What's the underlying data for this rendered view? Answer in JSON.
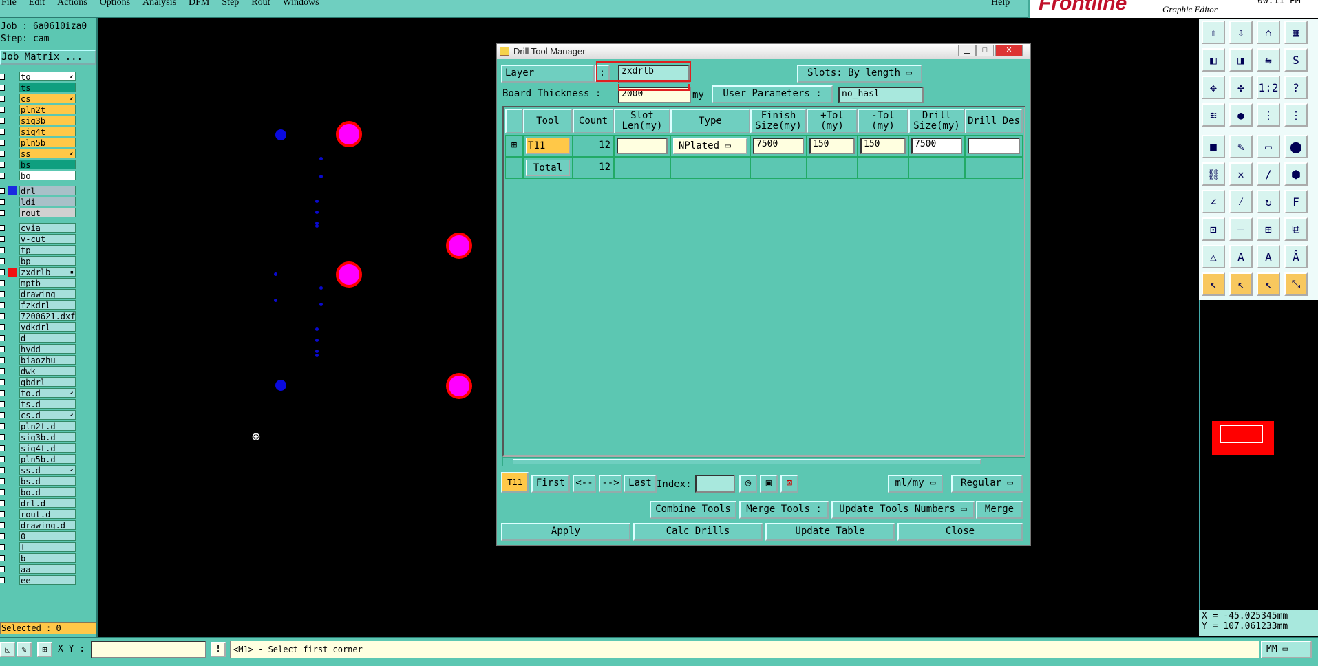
{
  "menubar": {
    "items": [
      "File",
      "Edit",
      "Actions",
      "Options",
      "Analysis",
      "DFM",
      "Step",
      "Rout",
      "Windows"
    ],
    "help": "Help"
  },
  "brand": {
    "logo": "Frontline",
    "subtitle": "Graphic Editor",
    "clock": "00:11 PM"
  },
  "left_panel": {
    "job": "Job : 6a0610iza0",
    "step": "Step: cam",
    "job_matrix_label": "Job Matrix ...",
    "layers": [
      {
        "name": "to",
        "color": "#ffffff",
        "marker": "⬋"
      },
      {
        "name": "ts",
        "color": "#0f9f7f",
        "marker": ""
      },
      {
        "name": "cs",
        "color": "#ffc848",
        "marker": "⬋"
      },
      {
        "name": "pln2t",
        "color": "#ffc848",
        "marker": ""
      },
      {
        "name": "sig3b",
        "color": "#ffc848",
        "marker": ""
      },
      {
        "name": "sig4t",
        "color": "#ffc848",
        "marker": ""
      },
      {
        "name": "pln5b",
        "color": "#ffc848",
        "marker": ""
      },
      {
        "name": "ss",
        "color": "#ffc848",
        "marker": "⬋"
      },
      {
        "name": "bs",
        "color": "#0f9f7f",
        "marker": ""
      },
      {
        "name": "bo",
        "color": "#ffffff",
        "marker": ""
      },
      {
        "name": "drl",
        "color": "#a8c0c8",
        "marker": ""
      },
      {
        "name": "ldi",
        "color": "#a8c0c8",
        "marker": ""
      },
      {
        "name": "rout",
        "color": "#d0d0d0",
        "marker": ""
      },
      {
        "name": "cvia",
        "color": "#a6dfdc",
        "marker": ""
      },
      {
        "name": "v-cut",
        "color": "#a6dfdc",
        "marker": ""
      },
      {
        "name": "tp",
        "color": "#a6dfdc",
        "marker": ""
      },
      {
        "name": "bp",
        "color": "#a6dfdc",
        "marker": ""
      },
      {
        "name": "zxdrlb",
        "color": "#a6dfdc",
        "marker": "▪"
      },
      {
        "name": "mptb",
        "color": "#a6dfdc",
        "marker": ""
      },
      {
        "name": "drawing",
        "color": "#a6dfdc",
        "marker": ""
      },
      {
        "name": "fzkdrl",
        "color": "#a6dfdc",
        "marker": ""
      },
      {
        "name": "7200621.dxf",
        "color": "#a6dfdc",
        "marker": ""
      },
      {
        "name": "ydkdrl",
        "color": "#a6dfdc",
        "marker": ""
      },
      {
        "name": "d",
        "color": "#a6dfdc",
        "marker": ""
      },
      {
        "name": "hydd",
        "color": "#a6dfdc",
        "marker": ""
      },
      {
        "name": "biaozhu",
        "color": "#a6dfdc",
        "marker": ""
      },
      {
        "name": "dwk",
        "color": "#a6dfdc",
        "marker": ""
      },
      {
        "name": "gbdrl",
        "color": "#a6dfdc",
        "marker": ""
      },
      {
        "name": "to.d",
        "color": "#a6dfdc",
        "marker": "⬋"
      },
      {
        "name": "ts.d",
        "color": "#a6dfdc",
        "marker": ""
      },
      {
        "name": "cs.d",
        "color": "#a6dfdc",
        "marker": "⬋"
      },
      {
        "name": "pln2t.d",
        "color": "#a6dfdc",
        "marker": ""
      },
      {
        "name": "sig3b.d",
        "color": "#a6dfdc",
        "marker": ""
      },
      {
        "name": "sig4t.d",
        "color": "#a6dfdc",
        "marker": ""
      },
      {
        "name": "pln5b.d",
        "color": "#a6dfdc",
        "marker": ""
      },
      {
        "name": "ss.d",
        "color": "#a6dfdc",
        "marker": "⬋"
      },
      {
        "name": "bs.d",
        "color": "#a6dfdc",
        "marker": ""
      },
      {
        "name": "bo.d",
        "color": "#a6dfdc",
        "marker": ""
      },
      {
        "name": "drl.d",
        "color": "#a6dfdc",
        "marker": ""
      },
      {
        "name": "rout.d",
        "color": "#a6dfdc",
        "marker": ""
      },
      {
        "name": "drawing.d",
        "color": "#a6dfdc",
        "marker": ""
      },
      {
        "name": "0",
        "color": "#a6dfdc",
        "marker": ""
      },
      {
        "name": "t",
        "color": "#a6dfdc",
        "marker": ""
      },
      {
        "name": "b",
        "color": "#a6dfdc",
        "marker": ""
      },
      {
        "name": "aa",
        "color": "#a6dfdc",
        "marker": ""
      },
      {
        "name": "ee",
        "color": "#a6dfdc",
        "marker": ""
      }
    ],
    "selected": "Selected : 0"
  },
  "dialog": {
    "title": "Drill Tool Manager",
    "layer_label": "Layer",
    "colon": ":",
    "layer_value": "zxdrlb",
    "slots_label": "Slots:",
    "slots_value": "By length",
    "board_thickness_label": "Board Thickness :",
    "board_thickness_value": "2000",
    "unit": "my",
    "user_params_label": "User Parameters :",
    "user_params_value": "no_hasl",
    "columns": [
      "Tool",
      "Count",
      "Slot Len(my)",
      "Type",
      "Finish Size(my)",
      "+Tol (my)",
      "-Tol (my)",
      "Drill Size(my)",
      "Drill Des"
    ],
    "rows": [
      {
        "tool": "T11",
        "count": "12",
        "slot_len": "",
        "type": "NPlated",
        "finish": "7500",
        "ptol": "150",
        "mtol": "150",
        "drill": "7500",
        "des": ""
      }
    ],
    "total": {
      "label": "Total",
      "count": "12"
    },
    "nav": {
      "current": "T11",
      "first": "First",
      "prev": "<--",
      "next": "-->",
      "last": "Last",
      "index_label": "Index:",
      "unit_select": "ml/my",
      "mode_select": "Regular"
    },
    "buttons": {
      "combine": "Combine Tools",
      "merge_tools": "Merge Tools :",
      "update_numbers": "Update Tools Numbers",
      "merge": "Merge",
      "apply": "Apply",
      "calc": "Calc Drills",
      "update_table": "Update Table",
      "close": "Close"
    }
  },
  "coords": {
    "x": "X = -45.025345mm",
    "y": "Y = 107.061233mm"
  },
  "status": {
    "xy_label": "X Y :",
    "prompt": "<M1> - Select first corner",
    "units": "MM"
  }
}
